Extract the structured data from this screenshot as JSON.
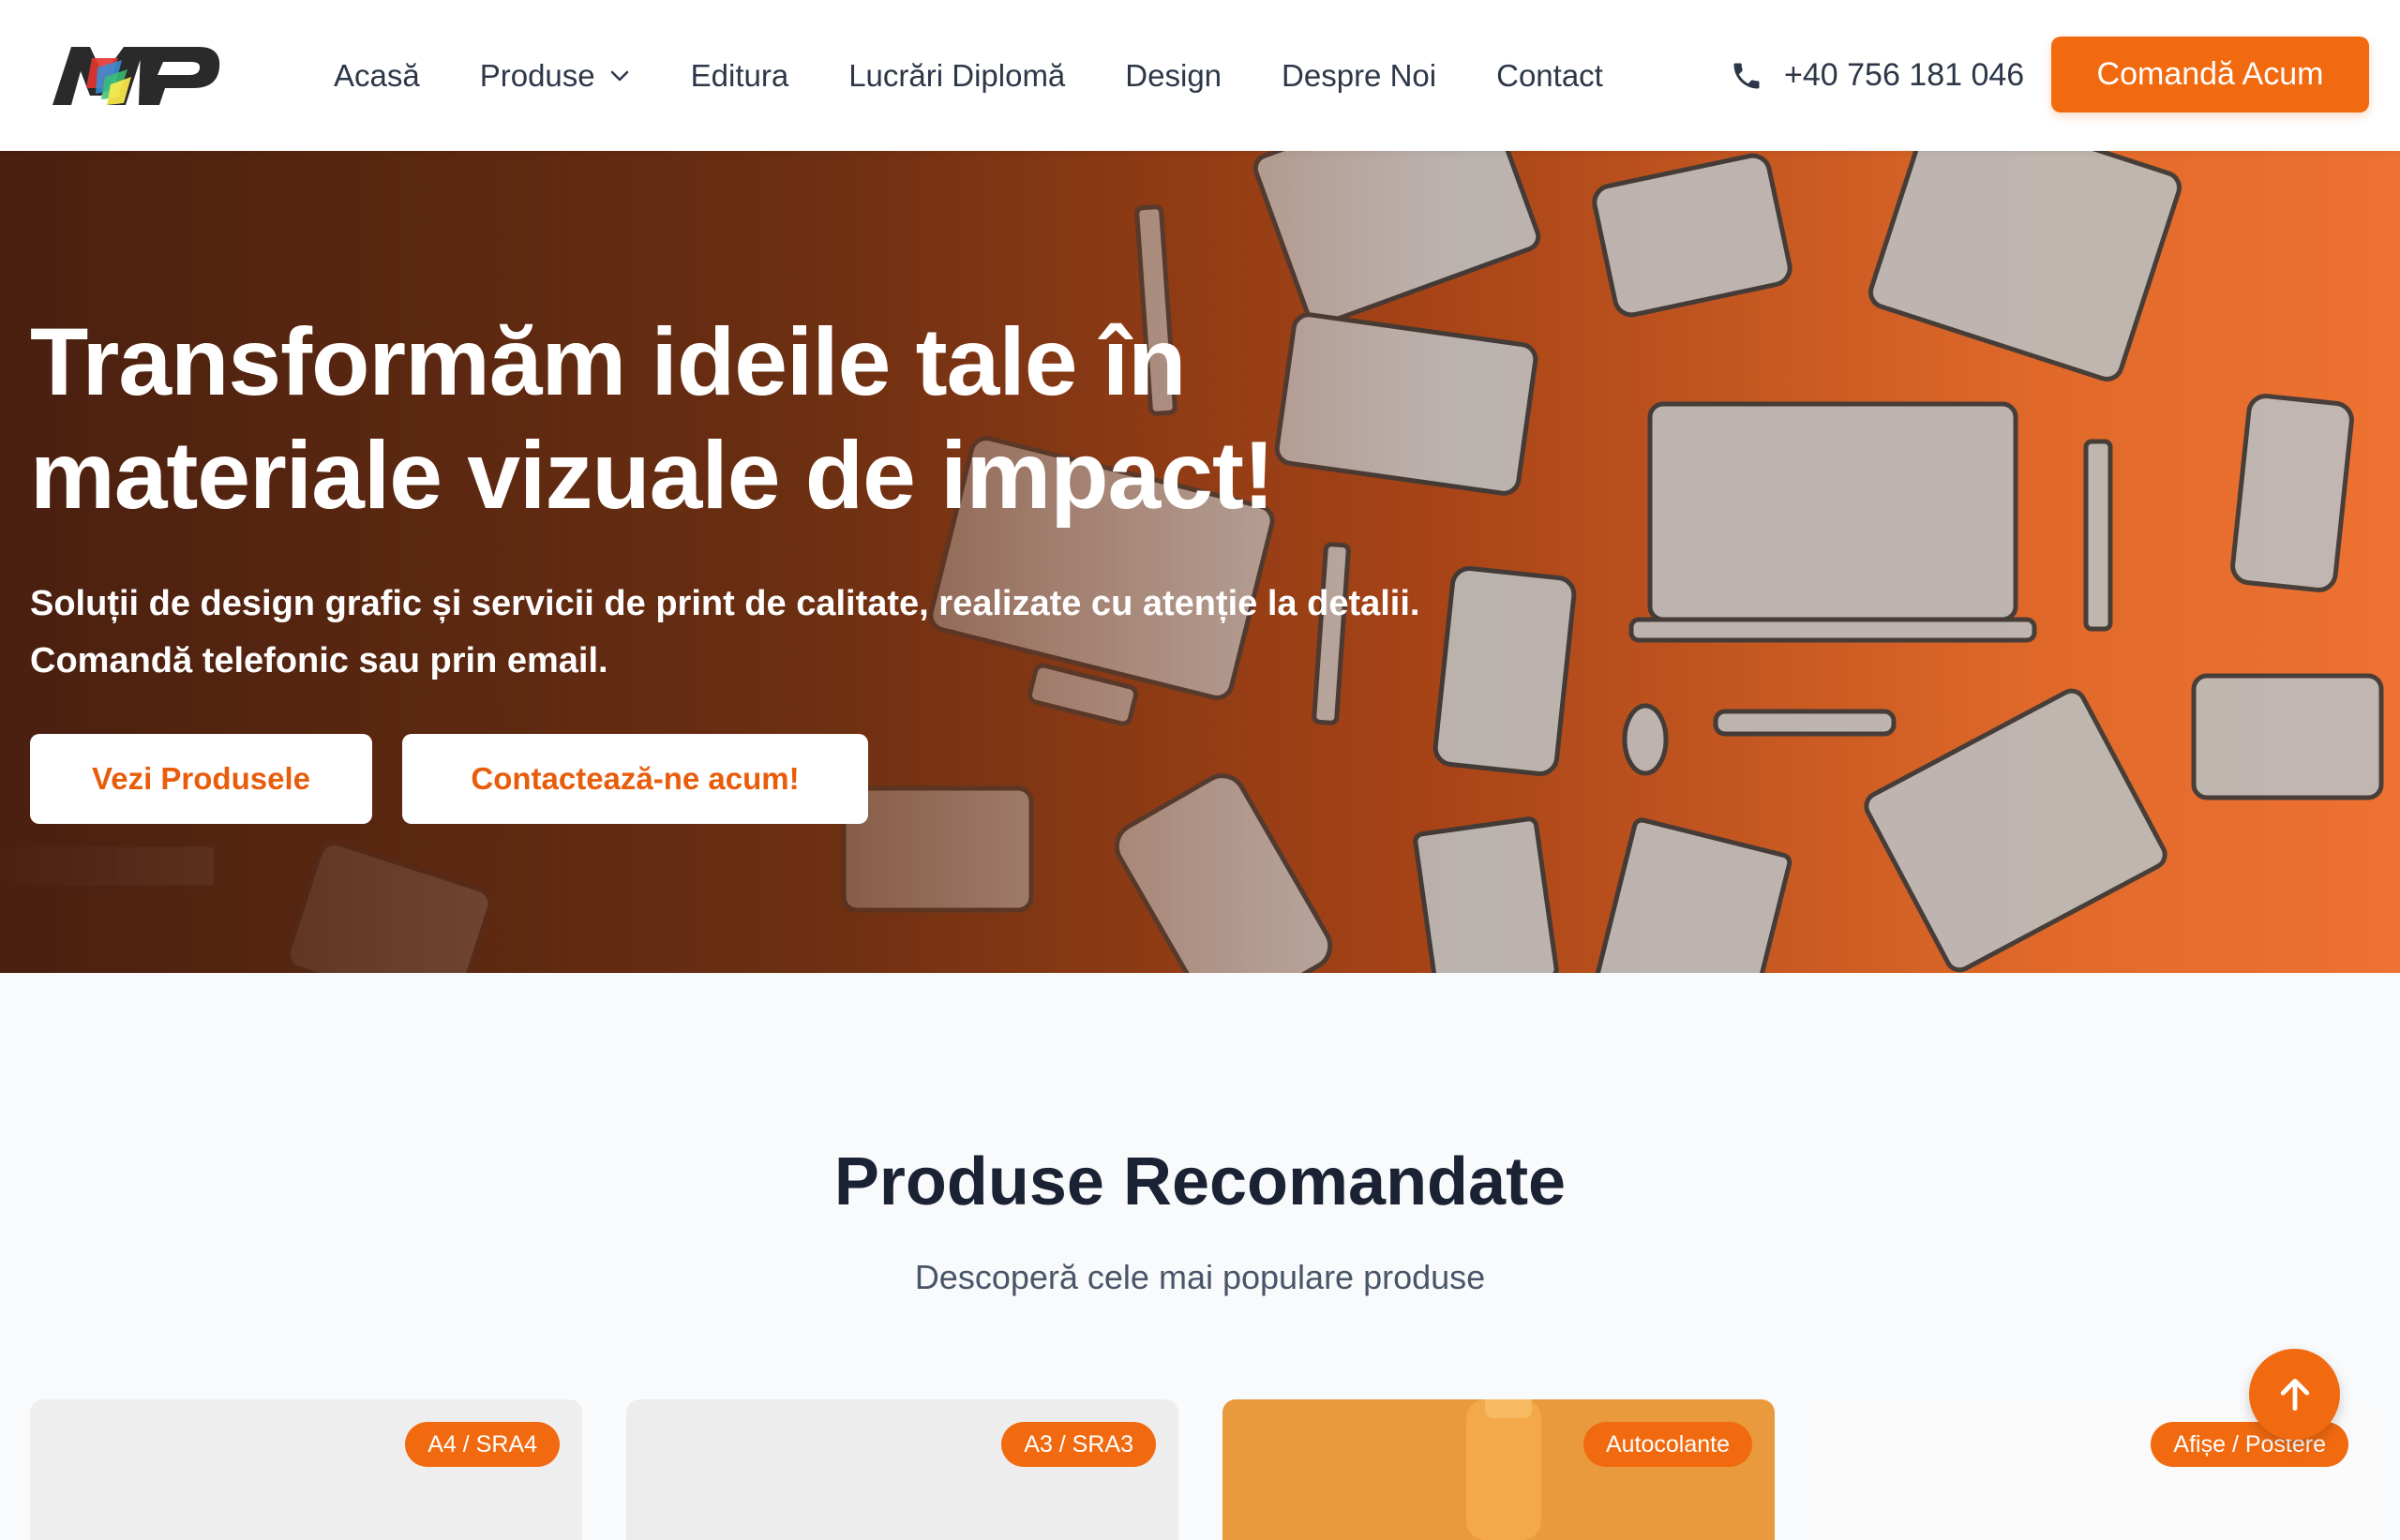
{
  "header": {
    "logo_text": "MP",
    "nav": [
      {
        "label": "Acasă",
        "has_dropdown": false
      },
      {
        "label": "Produse",
        "has_dropdown": true
      },
      {
        "label": "Editura",
        "has_dropdown": false
      },
      {
        "label": "Lucrări Diplomă",
        "has_dropdown": false
      },
      {
        "label": "Design",
        "has_dropdown": false
      },
      {
        "label": "Despre Noi",
        "has_dropdown": false
      },
      {
        "label": "Contact",
        "has_dropdown": false
      }
    ],
    "phone": "+40 756 181 046",
    "phone_icon": "phone-icon",
    "cta_label": "Comandă Acum"
  },
  "hero": {
    "title": "Transformăm ideile tale în materiale vizuale de impact!",
    "subtitle_line1": "Soluții de design grafic și servicii de print de calitate, realizate cu atenție la detalii.",
    "subtitle_line2": "Comandă telefonic sau prin email.",
    "btn_products": "Vezi Produsele",
    "btn_contact": "Contactează-ne acum!"
  },
  "featured": {
    "title": "Produse Recomandate",
    "subtitle": "Descoperă cele mai populare produse",
    "cards": [
      {
        "badge": "A4 / SRA4"
      },
      {
        "badge": "A3 / SRA3"
      },
      {
        "badge": "Autocolante"
      },
      {
        "badge": "Afișe / Postere"
      }
    ]
  },
  "colors": {
    "accent": "#f26a10",
    "text_dark": "#1a2233",
    "nav_text": "#2d3748"
  },
  "icons": {
    "scroll_top": "arrow-up-icon",
    "dropdown": "chevron-down-icon"
  }
}
